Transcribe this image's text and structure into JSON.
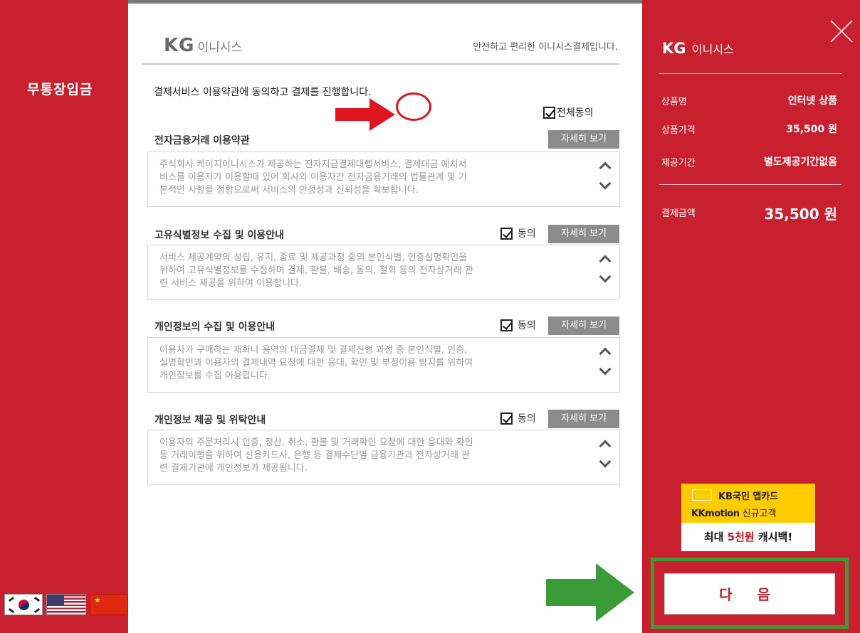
{
  "left": {
    "title": "무통장입금",
    "flags": [
      "korean-flag",
      "us-flag",
      "china-flag"
    ]
  },
  "header": {
    "logo_kg": "KG",
    "logo_name": "이니시스",
    "tagline": "안전하고 편리한 이니시스결제입니다."
  },
  "intro": "결제서비스 이용약관에 동의하고 결제를 진행합니다.",
  "all_agree_label": "전체동의",
  "sections": [
    {
      "title": "전자금융거래 이용약관",
      "agree_label": "",
      "detail_label": "자세히 보기",
      "lines": [
        "주식회사 케이지이니시스가 제공하는 전자지급결제대행서비스, 결제대금 예치서",
        "비스를 이용자가 이용할때 있어 회사와 이용자간 전자금융거래의 법률관계 및 기",
        "본적인 사항을 정함으로써 서비스의 안정성과 신뢰성을 확보합니다."
      ]
    },
    {
      "title": "고유식별정보 수집 및 이용안내",
      "agree_label": "동의",
      "detail_label": "자세히 보기",
      "lines": [
        "서비스 제공계약의 성립, 유지, 종료 및 제공과정 중의 본인식별, 인증실명확인을",
        "위하여 고유식별정보를 수집하며 결제, 환불, 배송, 동의, 철회 등의 전자상거래 관",
        "련 서비스 제공을 위하여 이용합니다."
      ]
    },
    {
      "title": "개인정보의 수집 및 이용안내",
      "agree_label": "동의",
      "detail_label": "자세히 보기",
      "lines": [
        "이용자가 구매하는 재화나 용역의 대금결제 및 결제진행 과정 중 본인식별, 인증,",
        "실명확인과 이용자의 결제내역 요청에 대한 응대, 확인 및 부정이용 방지를 위하여",
        "개인정보를 수집 이용합니다."
      ]
    },
    {
      "title": "개인정보 제공 및 위탁안내",
      "agree_label": "동의",
      "detail_label": "자세히 보기",
      "lines": [
        "이용자의 주문처리시 인증, 정산, 취소, 환불 및 거래확인 요청에 대한 응대와 확인",
        "등 거래이행을 위하여 신용카드사, 은행 등 결제수단별 금융기관과 전자상거래 관",
        "련 결제기관에 개인정보가 제공됩니다."
      ]
    }
  ],
  "summary": {
    "logo_kg": "KG",
    "logo_name": "이니시스",
    "rows": [
      {
        "label": "상품명",
        "value": "인터넷 상품"
      },
      {
        "label": "상품가격",
        "value": "35,500 원"
      },
      {
        "label": "제공기간",
        "value": "별도제공기간없음"
      }
    ],
    "total_label": "결제금액",
    "total_value": "35,500 원"
  },
  "ad": {
    "line1": "KB국민 앱카드",
    "line2_brand": "KKmotion",
    "line2_rest": "신규고객",
    "line3_pre": "최대 ",
    "line3_highlight": "5천원",
    "line3_post": " 캐시백!"
  },
  "next_button": "다 음",
  "colors": {
    "brand_red": "#c8202e",
    "annotation_red": "#e0141e",
    "annotation_green": "#3a9b37",
    "ad_yellow": "#ffcc00"
  }
}
